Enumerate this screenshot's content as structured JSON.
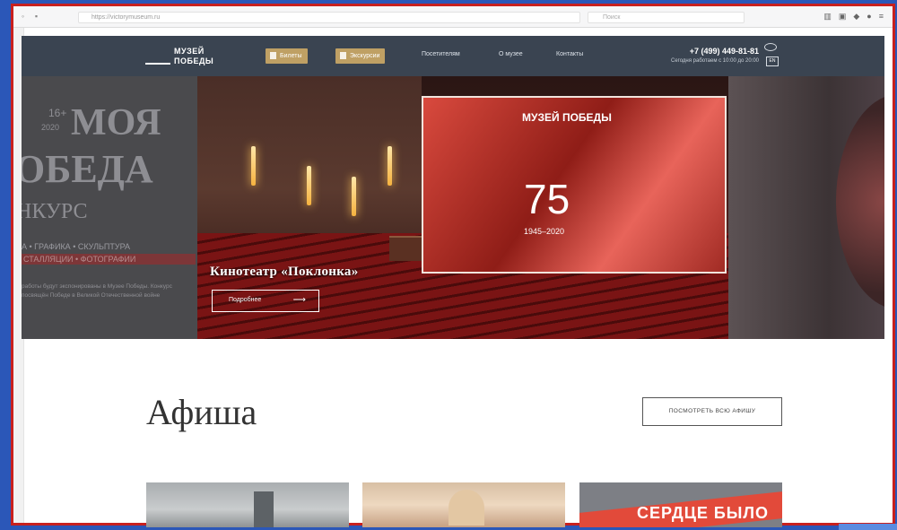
{
  "browser": {
    "url": "https://victorymuseum.ru",
    "search_placeholder": "Поиск"
  },
  "site": {
    "logo_text": "МУЗЕЙ ПОБЕДЫ",
    "nav": {
      "tickets": "Билеты",
      "excursions": "Экскурсии",
      "visitors": "Посетителям",
      "about": "О музее",
      "contacts": "Контакты"
    },
    "phone": "+7 (499) 449-81-81",
    "hours": "Сегодня работаем с 10:00 до 20:00",
    "lang": "EN"
  },
  "hero": {
    "left_slide": {
      "age": "16+",
      "year": "2020",
      "title_line1": "МОЯ",
      "title_line2": "ОБЕДА",
      "title_line3": "НКУРС",
      "categories_line1": "А • ГРАФИКА • СКУЛЬПТУРА",
      "categories_line2": "СТАЛЛЯЦИИ • ФОТОГРАФИИ",
      "description": "работы будут экспонированы в Музее Победы. Конкурс посвящён Победе в Великой Отечественной войне"
    },
    "screen_logo": "МУЗЕЙ ПОБЕДЫ",
    "screen_number": "75",
    "screen_years": "1945–2020",
    "title": "Кинотеатр «Поклонка»",
    "button": "Подробнее"
  },
  "afisha": {
    "title": "Афиша",
    "all_button": "ПОСМОТРЕТЬ ВСЮ АФИШУ"
  },
  "cards": [
    {
      "label": ""
    },
    {
      "label": ""
    },
    {
      "label": "СЕРДЦЕ БЫЛО"
    }
  ]
}
